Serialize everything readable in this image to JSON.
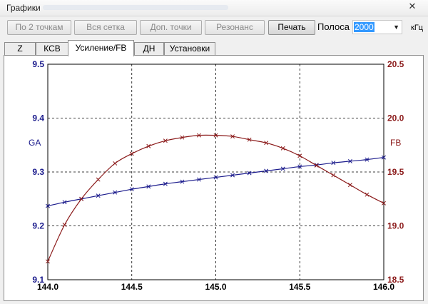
{
  "window": {
    "title": "Графики"
  },
  "toolbar": {
    "buttons": [
      {
        "label": "По 2 точкам",
        "enabled": false
      },
      {
        "label": "Вся сетка",
        "enabled": false
      },
      {
        "label": "Доп. точки",
        "enabled": false
      },
      {
        "label": "Резонанс",
        "enabled": false
      },
      {
        "label": "Печать",
        "enabled": true
      }
    ],
    "bandwidth_label": "Полоса",
    "bandwidth_value": "2000",
    "bandwidth_unit": "кГц"
  },
  "tabs": [
    {
      "label": "Z",
      "active": false
    },
    {
      "label": "КСВ",
      "active": false
    },
    {
      "label": "Усиление/FB",
      "active": true
    },
    {
      "label": "ДН",
      "active": false
    },
    {
      "label": "Установки",
      "active": false
    }
  ],
  "icons": {
    "close": "close-icon",
    "dropdown": "chevron-down-icon"
  },
  "colors": {
    "ga": "#1b1b8c",
    "fb": "#8b1a1a",
    "grid": "#000000"
  },
  "chart_data": {
    "type": "line",
    "x_ticks": [
      "144.0",
      "144.5",
      "145.0",
      "145.5",
      "146.0"
    ],
    "xlim": [
      144.0,
      146.0
    ],
    "ylabel_left": "GA",
    "ylabel_right": "FB",
    "ylim_left": [
      9.1,
      9.5
    ],
    "ylim_right": [
      18.5,
      20.5
    ],
    "y_ticks_left": [
      "9.1",
      "9.2",
      "9.3",
      "9.4",
      "9.5"
    ],
    "y_ticks_right": [
      "18.5",
      "19.0",
      "19.5",
      "20.0",
      "20.5"
    ],
    "grid": "dashed",
    "series": [
      {
        "name": "GA",
        "axis": "left",
        "x": [
          144.0,
          144.1,
          144.2,
          144.3,
          144.4,
          144.5,
          144.6,
          144.7,
          144.8,
          144.9,
          145.0,
          145.1,
          145.2,
          145.3,
          145.4,
          145.5,
          145.6,
          145.7,
          145.8,
          145.9,
          146.0
        ],
        "y": [
          9.237,
          9.244,
          9.25,
          9.256,
          9.262,
          9.268,
          9.273,
          9.278,
          9.282,
          9.286,
          9.29,
          9.294,
          9.298,
          9.302,
          9.306,
          9.31,
          9.313,
          9.317,
          9.32,
          9.323,
          9.327
        ]
      },
      {
        "name": "FB",
        "axis": "right",
        "x": [
          144.0,
          144.1,
          144.2,
          144.3,
          144.4,
          144.5,
          144.6,
          144.7,
          144.8,
          144.9,
          145.0,
          145.1,
          145.2,
          145.3,
          145.4,
          145.5,
          145.6,
          145.7,
          145.8,
          145.9,
          146.0
        ],
        "y": [
          18.67,
          19.01,
          19.25,
          19.43,
          19.58,
          19.67,
          19.74,
          19.79,
          19.82,
          19.84,
          19.84,
          19.83,
          19.8,
          19.77,
          19.72,
          19.65,
          19.56,
          19.47,
          19.38,
          19.29,
          19.21
        ]
      }
    ]
  }
}
